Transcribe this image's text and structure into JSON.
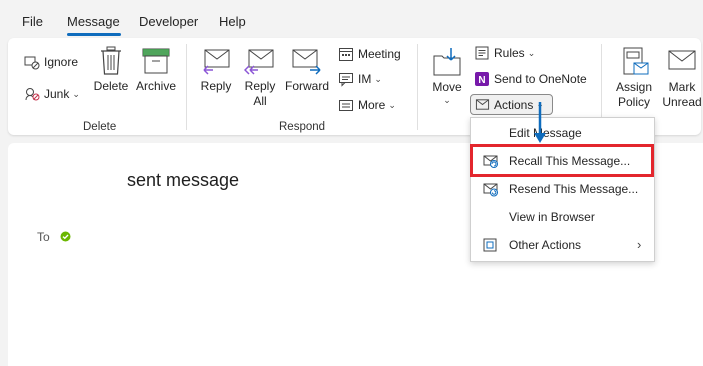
{
  "tabs": [
    {
      "label": "File"
    },
    {
      "label": "Message"
    },
    {
      "label": "Developer"
    },
    {
      "label": "Help"
    }
  ],
  "active_tab": "Message",
  "ribbon": {
    "groups": {
      "delete": "Delete",
      "respond": "Respond"
    },
    "ignore": "Ignore",
    "junk": "Junk",
    "delete_btn": "Delete",
    "archive": "Archive",
    "reply": "Reply",
    "reply_all_1": "Reply",
    "reply_all_2": "All",
    "forward": "Forward",
    "meeting": "Meeting",
    "im": "IM",
    "more": "More",
    "move": "Move",
    "rules": "Rules",
    "send_onenote": "Send to OneNote",
    "actions": "Actions",
    "assign_1": "Assign",
    "assign_2": "Policy",
    "mark_1": "Mark",
    "mark_2": "Unread"
  },
  "message": {
    "subject": "sent message",
    "to_label": "To"
  },
  "actions_menu": {
    "items": [
      {
        "label": "Edit Message"
      },
      {
        "label": "Recall This Message..."
      },
      {
        "label": "Resend This Message..."
      },
      {
        "label": "View in Browser"
      },
      {
        "label": "Other Actions"
      }
    ]
  },
  "colors": {
    "accent": "#0f6cbd",
    "highlight_border": "#e3262d",
    "onenote_purple": "#7719aa",
    "status_green": "#6bb700"
  }
}
